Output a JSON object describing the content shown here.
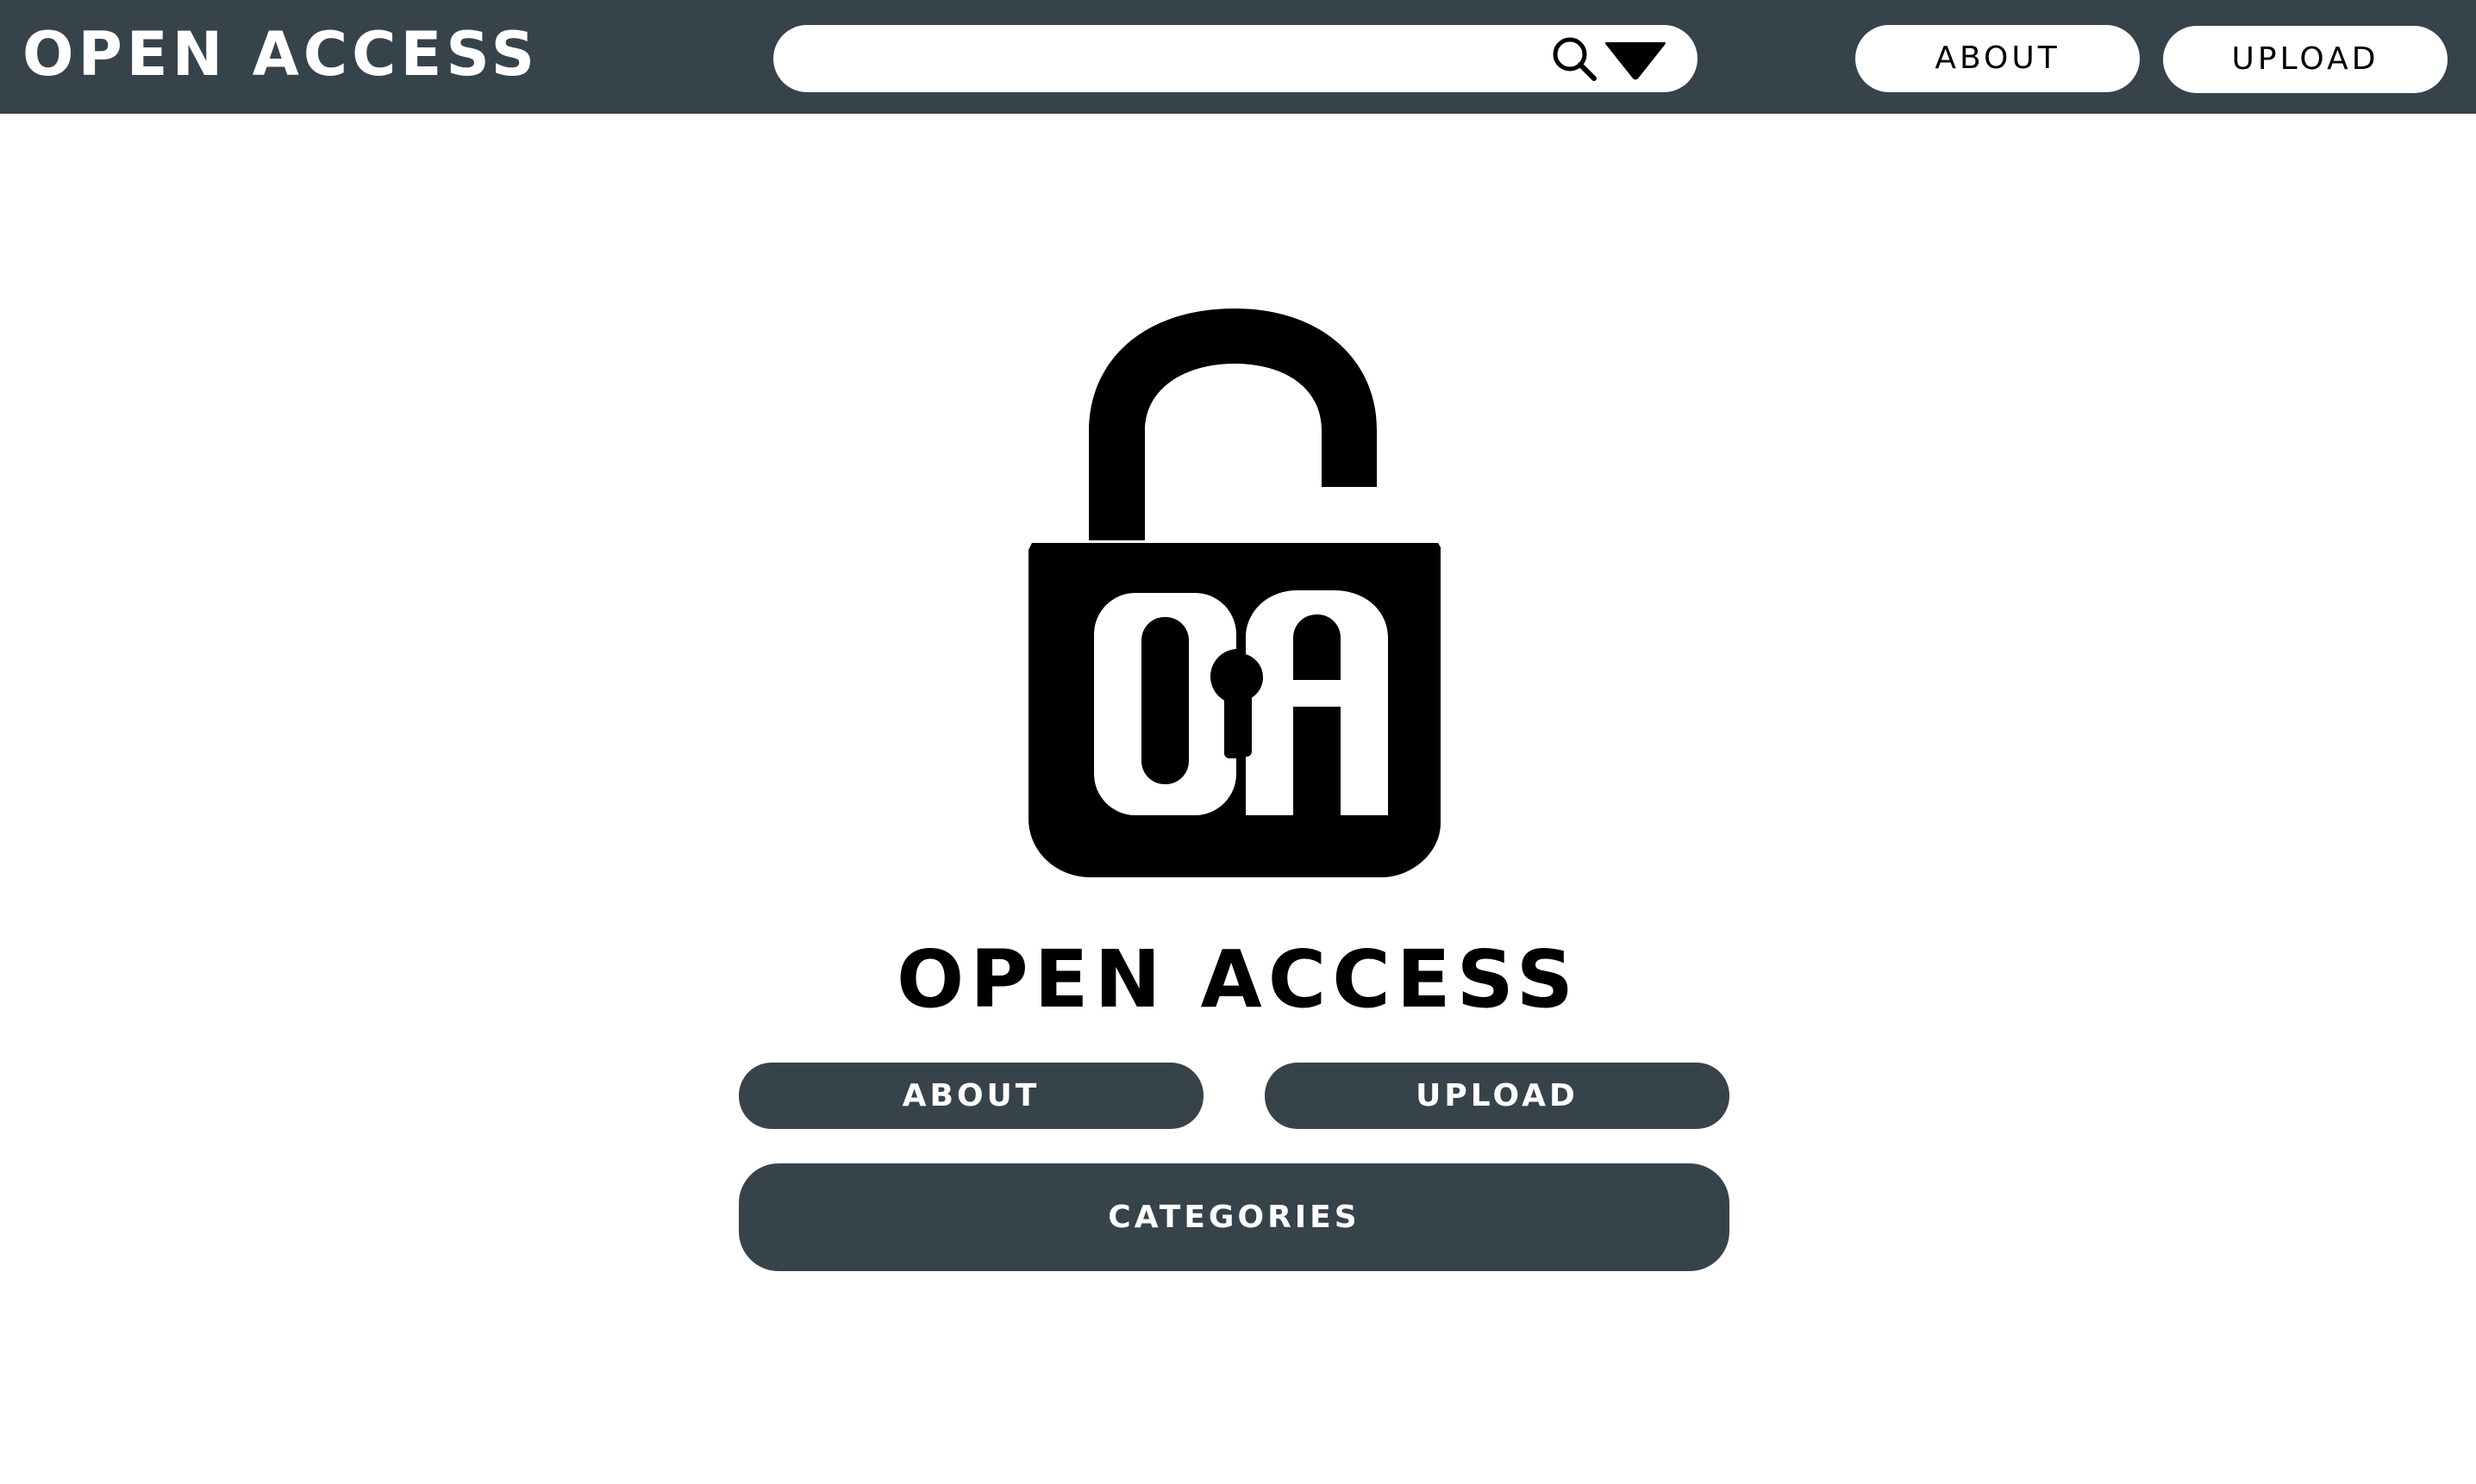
{
  "header": {
    "brand": "OPEN ACCESS",
    "search": {
      "value": "",
      "placeholder": "",
      "search_icon": "magnifier-icon",
      "dropdown_icon": "triangle-down-icon"
    },
    "nav": {
      "about_label": "ABOUT",
      "upload_label": "UPLOAD"
    }
  },
  "hero": {
    "logo_icon": "open-padlock-icon",
    "logo_text": "OA",
    "title": "OPEN ACCESS",
    "about_label": "ABOUT",
    "upload_label": "UPLOAD",
    "categories_label": "CATEGORIES"
  },
  "colors": {
    "bar": "#37434a",
    "background": "#ffffff",
    "text_dark": "#000000",
    "text_light": "#ffffff"
  }
}
